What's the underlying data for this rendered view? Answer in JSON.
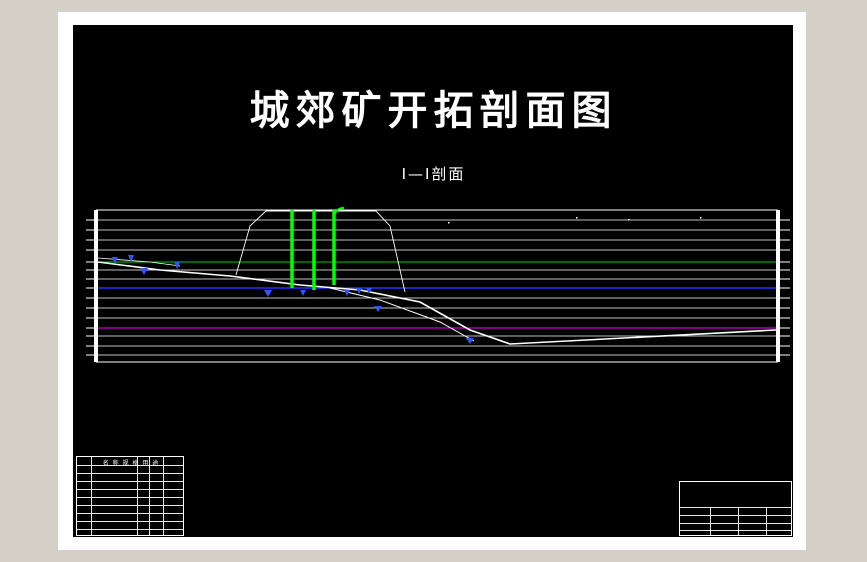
{
  "drawing": {
    "title": "城郊矿开拓剖面图",
    "section_label": "Ⅰ—Ⅰ剖面"
  },
  "legend_table": {
    "header": "名 称 规 格 用 途"
  },
  "colors": {
    "background": "#000000",
    "frame": "#ffffff",
    "shaft": "#00ff00",
    "horizon_green": "#00cc00",
    "horizon_blue": "#2233ff",
    "horizon_magenta": "#ff00ff",
    "marker": "#3355ff"
  }
}
